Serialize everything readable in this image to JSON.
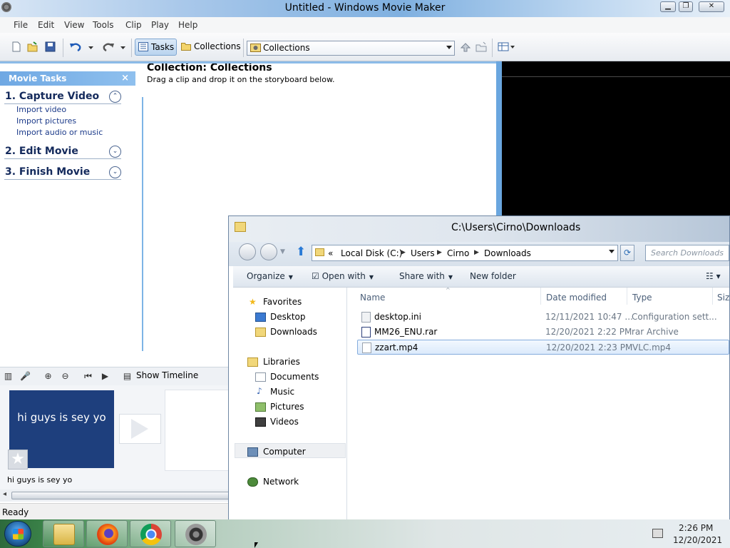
{
  "moviemaker": {
    "title": "Untitled - Windows Movie Maker",
    "menu": [
      "File",
      "Edit",
      "View",
      "Tools",
      "Clip",
      "Play",
      "Help"
    ],
    "toolbar": {
      "tasks_label": "Tasks",
      "collections_label": "Collections",
      "combo_value": "Collections"
    },
    "task_pane": {
      "header": "Movie Tasks",
      "close_glyph": "×",
      "sections": [
        {
          "title": "1. Capture Video",
          "links": [
            "Import video",
            "Import pictures",
            "Import audio or music"
          ],
          "chevron": "⌃"
        },
        {
          "title": "2. Edit Movie",
          "chevron": "⌄"
        },
        {
          "title": "3. Finish Movie",
          "chevron": "⌄"
        }
      ]
    },
    "collection": {
      "title": "Collection: Collections",
      "subtitle": "Drag a clip and drop it on the storyboard below."
    },
    "storyboard": {
      "show_timeline": "Show Timeline",
      "clip_text": "hi guys is sey yo",
      "clip_caption": "hi guys is sey yo"
    },
    "status": "Ready"
  },
  "explorer": {
    "title": "C:\\Users\\Cirno\\Downloads",
    "breadcrumb": [
      "Local Disk (C:)",
      "Users",
      "Cirno",
      "Downloads"
    ],
    "breadcrumb_prefix": "«",
    "search_placeholder": "Search Downloads",
    "commands": {
      "organize": "Organize",
      "open_with": "Open with",
      "share_with": "Share with",
      "new_folder": "New folder"
    },
    "nav": {
      "favorites": "Favorites",
      "desktop": "Desktop",
      "downloads": "Downloads",
      "libraries": "Libraries",
      "documents": "Documents",
      "music": "Music",
      "pictures": "Pictures",
      "videos": "Videos",
      "computer": "Computer",
      "network": "Network"
    },
    "columns": {
      "name": "Name",
      "date": "Date modified",
      "type": "Type",
      "size": "Size"
    },
    "files": [
      {
        "name": "desktop.ini",
        "date": "12/11/2021 10:47 ...",
        "type": "Configuration sett..."
      },
      {
        "name": "MM26_ENU.rar",
        "date": "12/20/2021 2:22 PM",
        "type": "rar Archive"
      },
      {
        "name": "zzart.mp4",
        "date": "12/20/2021 2:23 PM",
        "type": "VLC.mp4",
        "selected": true
      }
    ]
  },
  "taskbar": {
    "time": "2:26 PM",
    "date": "12/20/2021"
  }
}
